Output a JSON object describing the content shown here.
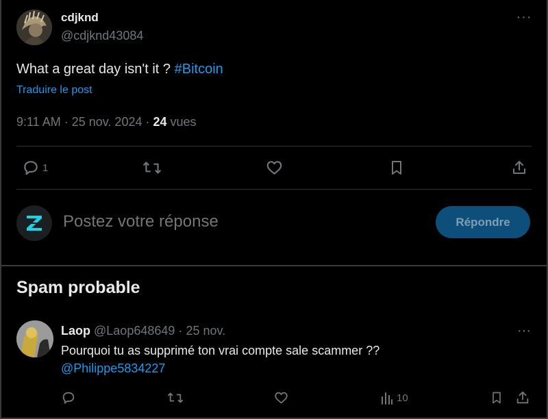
{
  "post": {
    "author_name": "cdjknd",
    "author_handle": "@cdjknd43084",
    "text": "What a great day isn't it ? ",
    "hashtag": "#Bitcoin",
    "translate_label": "Traduire le post",
    "time": "9:11 AM",
    "date": "25 nov. 2024",
    "views_count": "24",
    "views_label": "vues",
    "more_icon": "more-horizontal-icon"
  },
  "actions": {
    "reply_count": "1",
    "retweet_count": "",
    "like_count": "",
    "bookmark_count": ""
  },
  "composer": {
    "placeholder": "Postez votre réponse",
    "button_label": "Répondre"
  },
  "section": {
    "title": "Spam probable"
  },
  "reply": {
    "author_name": "Laop",
    "author_handle": "@Laop648649",
    "date": "25 nov.",
    "text": "Pourquoi tu as supprimé ton vrai compte sale scammer ??",
    "mention": "@Philippe5834227",
    "views_count": "10"
  },
  "colors": {
    "background": "#000000",
    "text": "#e7e9ea",
    "muted": "#71767b",
    "accent": "#1d9bf0",
    "divider": "#2f3336",
    "reply_button_bg": "#0e4e7a"
  }
}
